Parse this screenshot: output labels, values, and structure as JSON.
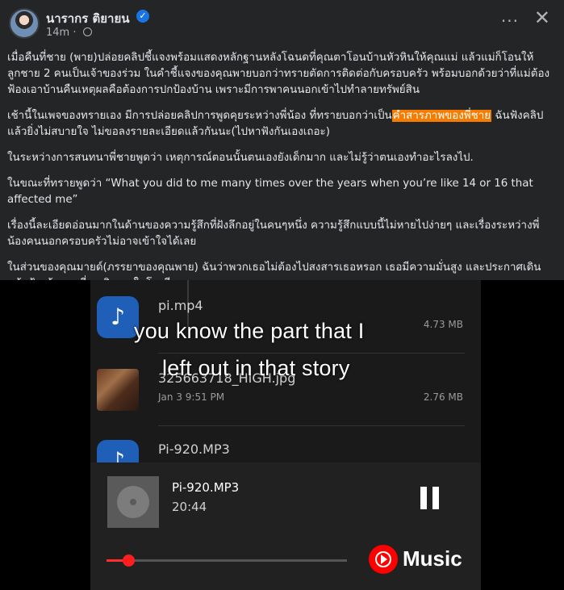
{
  "post": {
    "author": "นารากร ติยายน",
    "time": "14m",
    "more": "···",
    "close": "✕",
    "verified": "✓"
  },
  "body": {
    "p1": "เมื่อคืนที่ชาย (พาย)ปล่อยคลิปชี้แจงพร้อมแสดงหลักฐานหลังโฉนดที่คุณตาโอนบ้านหัวหินให้คุณแม่  แล้วแม่ก็โอนให้ลูกชาย 2 คนเป็นเจ้าของร่วม  ในคำชี้แจงของคุณพายบอกว่าทรายตัดการติดต่อกับครอบครัว  พร้อมบอกด้วยว่าที่แม่ต้องฟ้องเอาบ้านคืนเหตุผลคือต้องการปกป้องบ้าน  เพราะมีการพาคนนอกเข้าไปทำลายทรัพย์สิน",
    "p2_before": "เช้านี้ในเพจของทรายเอง  มีการปล่อยคลิปการพูดคุยระหว่างพี่น้อง  ที่ทรายบอกว่าเป็น",
    "p2_highlight": "คำสารภาพของพี่ชาย",
    "p2_after": "  ฉันฟังคลิปแล้วยิ่งไม่สบายใจ  ไม่ขอลงรายละเอียดแล้วกันนะ(ไปหาฟังกันเองเถอะ)",
    "p3": "ในระหว่างการสนทนาพี่ชายพูดว่า เหตุการณ์ตอนนั้นตนเองยังเด็กมาก  และไม่รู้ว่าตนเองทำอะไรลงไป.",
    "p4": "ในขณะที่ทรายพูดว่า “What you did to me many times over the years when you’re like 14 or 16 that affected me”",
    "p5": "เรื่องนี้ละเอียดอ่อนมากในด้านของความรู้สึกที่ฝังลึกอยู่ในคนๆหนึ่ง  ความรู้สึกแบบนี้ไม่หายไปง่ายๆ  และเรื่องระหว่างพี่น้องคนนอกครอบครัวไม่อาจเข้าใจได้เลย",
    "p6": "ในส่วนของคุณมายด์(ภรรยาของคุณพาย) ฉันว่าพวกเธอไม่ต้องไปสงสารเธอหรอก  เธอมีความมั่นสูง  และประกาศเดินหน้าฟ้องร้องคนที่ละเมิดเธอในโซเชียลทุกคน"
  },
  "media": {
    "files": [
      {
        "name": "pi.mp4",
        "size": "4.73 MB",
        "icon": "♪"
      },
      {
        "name": "325663718_HIGH.jpg",
        "date": "Jan 3  9:51 PM",
        "size": "2.76 MB"
      },
      {
        "name": "Pi-920.MP3",
        "icon": "♪"
      }
    ],
    "subtitle_line1": "you know the part that I",
    "subtitle_line2": "left out in that story",
    "player": {
      "title": "Pi-920.MP3",
      "time": "20:44",
      "progress": 0.09,
      "app": "Music"
    }
  }
}
